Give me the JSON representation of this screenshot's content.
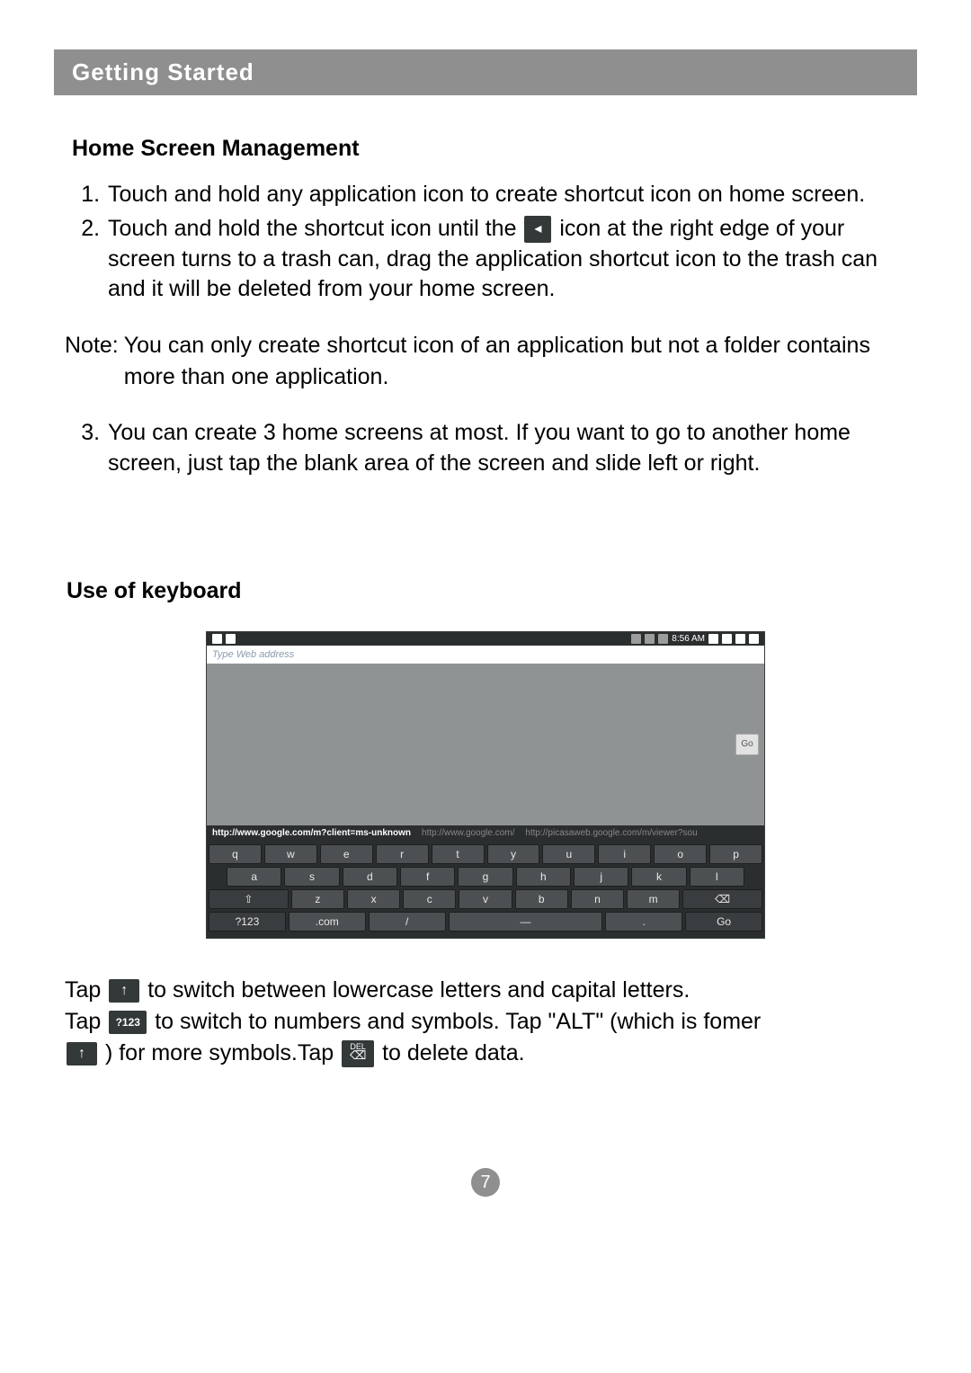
{
  "header": {
    "title": "Getting Started"
  },
  "section_home": {
    "title": "Home Screen Management",
    "item1": "Touch and hold any application icon to create shortcut icon on home screen.",
    "item2a": "Touch and hold the shortcut icon until the ",
    "item2b": " icon at the right edge of your screen turns to a trash can, drag the application shortcut icon to the trash can and it will be  deleted from your home screen.",
    "note_label": "Note: ",
    "note_text": "You can only create shortcut icon of an application but not a folder contains more than one application.",
    "item3": "You can create 3 home screens at most. If you want to go to another home screen, just tap the blank area of the screen and slide left or right."
  },
  "section_keyboard": {
    "title": "Use of keyboard",
    "status_time": "8:56 AM",
    "url_placeholder": "Type Web address",
    "go": "Go",
    "suggest1": "http://www.google.com/m?client=ms-unknown",
    "suggest2": "http://www.google.com/",
    "suggest3": "http://picasaweb.google.com/m/viewer?sou",
    "row1": [
      "q",
      "w",
      "e",
      "r",
      "t",
      "y",
      "u",
      "i",
      "o",
      "p"
    ],
    "row2": [
      "a",
      "s",
      "d",
      "f",
      "g",
      "h",
      "j",
      "k",
      "l"
    ],
    "row3_shift": "⇧",
    "row3": [
      "z",
      "x",
      "c",
      "v",
      "b",
      "n",
      "m"
    ],
    "row3_del": "⌫",
    "row4": {
      "num": "?123",
      "com": ".com",
      "slash": "/",
      "space": "␣",
      "dot": ".",
      "go": "Go"
    },
    "para1a": "Tap ",
    "para1b": " to switch between lowercase letters and capital letters.",
    "para2a": "Tap ",
    "para2b": " to switch to numbers and symbols. Tap \"ALT\" (which is fomer",
    "para3a": " ) for more symbols.Tap ",
    "para3b": " to delete data.",
    "shift_glyph": "↑",
    "n123_glyph": "?123",
    "del_top": "DEL",
    "del_glyph": "⌫"
  },
  "page_number": "7"
}
